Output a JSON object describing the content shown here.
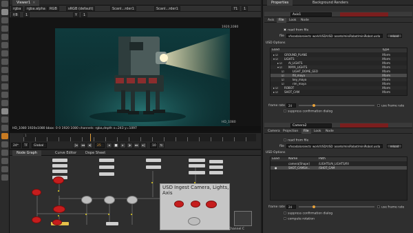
{
  "viewer": {
    "tab": "Viewer1",
    "toolbar": [
      "rgba",
      "rgba.alpha",
      "RGB",
      "sRGB (default)",
      "Scanl...rder1",
      "Scanl...rder1",
      "71",
      "1"
    ],
    "toolbar2": [
      "f/8",
      "1",
      "Y",
      "1"
    ],
    "format_label": "1920,1080",
    "bottom_label": "HD_1080",
    "info": "HD_1080 1920x1080  bbox: 0 0 1920 1080 channels: rgba,depth  x=243 y=1097",
    "timeline": {
      "fps": "24*",
      "tf": "TF",
      "scope": "Global",
      "current_frame": "25",
      "step": "10",
      "ticks": [
        "1",
        "",
        "",
        "",
        "",
        "",
        "",
        "",
        "",
        "",
        "",
        "",
        "",
        "",
        "",
        "",
        "",
        "",
        "",
        "",
        ""
      ]
    }
  },
  "nodegraph": {
    "tabs": [
      "Node Graph",
      "Curve Editor",
      "Dope Sheet"
    ],
    "backdrop_title": "USD Ingest Camera, Lights, Axis",
    "channel_label": "Channel C"
  },
  "properties": {
    "tabs": [
      "Properties",
      "Background Renders"
    ],
    "panel1": {
      "name": "Axis1",
      "subtabs": [
        "Axis",
        "File",
        "Look",
        "Node"
      ],
      "read_from_file": "read from file",
      "file_label": "file",
      "file_value": "vfxsada/projects_work/USD/USD_assets/miniRobot/miniRobot.usda",
      "reload": "reload",
      "usd_options": "USD Options",
      "col_load": "Load",
      "col_type": "Type",
      "rows": [
        {
          "name": "GROUND_PLANE",
          "type": "Xform"
        },
        {
          "name": "LIGHTS",
          "type": "Xform"
        },
        {
          "name": "AI_LIGHTS",
          "type": "Xform"
        },
        {
          "name": "MAYA_LIGHTS",
          "type": "Xform"
        },
        {
          "name": "LIGHT_DOME_GEO",
          "type": "Xform"
        },
        {
          "name": "fill_maya",
          "type": "Xform"
        },
        {
          "name": "key_maya",
          "type": "Xform"
        },
        {
          "name": "rim_maya",
          "type": "Xform"
        },
        {
          "name": "ROBOT",
          "type": "Xform"
        },
        {
          "name": "SHOT_CAM",
          "type": "Xform"
        }
      ],
      "frame_rate_label": "frame rate",
      "frame_rate": "24",
      "use_frame_rate": "use frame rate",
      "suppress": "suppress confirmation dialog"
    },
    "panel2": {
      "name": "Camera2",
      "subtabs": [
        "Camera",
        "Projection",
        "File",
        "Look",
        "Node"
      ],
      "read_from_file": "read from file",
      "file_label": "file",
      "file_value": "vfxsada/projects_work/USD/USD_assets/miniRobot/miniRobot.usda",
      "reload": "reload",
      "usd_options": "USD Options",
      "col_load": "Load",
      "col_name": "Name",
      "col_path": "Path",
      "rows": [
        {
          "name": "camera[Shape]",
          "path": "/LIGHTS/AI_LIGHTS/fill"
        },
        {
          "name": "SHOT_CAMSH...",
          "path": "/SHOT_CAM"
        }
      ],
      "frame_rate_label": "frame rate",
      "frame_rate": "24",
      "use_frame_rate": "use frame rate",
      "suppress": "suppress confirmation dialog",
      "compute_rotation": "compute rotation"
    }
  },
  "colors": {
    "accent": "#e8a23a",
    "node_red": "#c51d1d",
    "panel_red": "#7a1e1e"
  }
}
